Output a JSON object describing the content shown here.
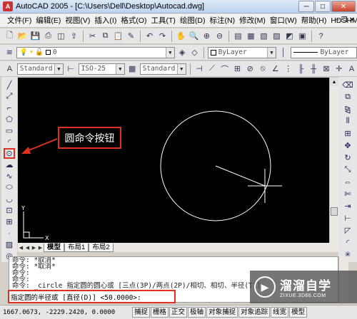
{
  "window": {
    "app_icon": "A",
    "title": "AutoCAD 2005 - [C:\\Users\\Dell\\Desktop\\Autocad.dwg]",
    "buttons": [
      "minimize-icon",
      "maximize-icon",
      "close-icon"
    ]
  },
  "menubar": {
    "items": [
      "文件(F)",
      "编辑(E)",
      "视图(V)",
      "插入(I)",
      "格式(O)",
      "工具(T)",
      "绘图(D)",
      "标注(N)",
      "修改(M)",
      "窗口(W)",
      "帮助(H)",
      "HDSHM"
    ]
  },
  "layers": {
    "layer_value": "0",
    "color_value": "ByLayer",
    "linetype_value": "ByLayer"
  },
  "styles": {
    "text_style": "Standard",
    "dim_style": "ISO-25",
    "table_style": "Standard"
  },
  "canvas": {
    "ucs_x": "X",
    "ucs_y": "Y"
  },
  "callout": {
    "label": "圆命令按钮"
  },
  "tabs": {
    "items": [
      "模型",
      "布局1",
      "布局2"
    ],
    "active": "模型"
  },
  "command": {
    "lines": [
      "命令: *取消*",
      "命令: *取消*",
      "命令:",
      "命令:",
      "命令:  _circle 指定圆的圆心或 [三点(3P)/两点(2P)/相切、相切、半径(T)]:"
    ],
    "prompt": "指定圆的半径或 [直径(D)] <50.0000>:"
  },
  "statusbar": {
    "coords": "1667.0673,  -2229.2420,  0.0000",
    "buttons": [
      "捕捉",
      "栅格",
      "正交",
      "极轴",
      "对象捕捉",
      "对象追踪",
      "线宽",
      "模型"
    ]
  },
  "watermark": {
    "main": "溜溜自学",
    "sub": "ZIXUE.3D66.COM"
  },
  "colors": {
    "highlight": "#e03020",
    "canvas_bg": "#000000",
    "drawing": "#ffffff"
  }
}
